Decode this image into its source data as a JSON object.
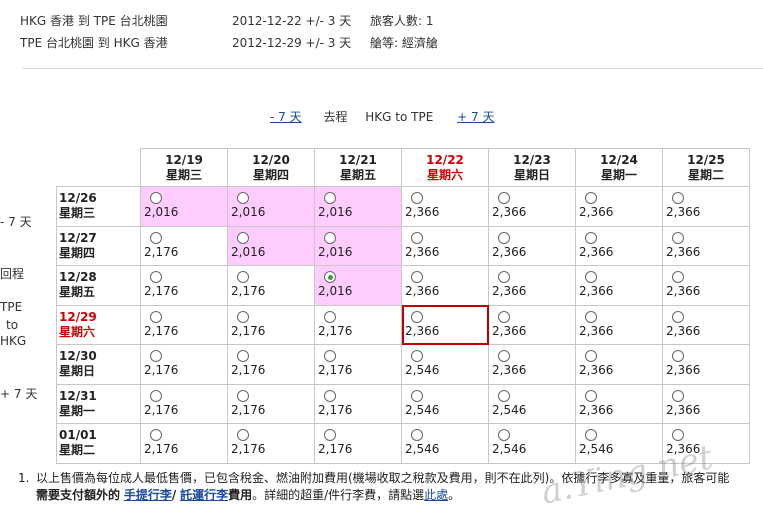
{
  "summary": {
    "outbound": {
      "route": "HKG 香港 到 TPE 台北桃園",
      "date": "2012-12-22  +/- 3 天",
      "info": "旅客人數:  1"
    },
    "inbound": {
      "route": "TPE 台北桃園 到 HKG 香港",
      "date": "2012-12-29  +/- 3 天",
      "info": "艙等:  經濟艙"
    }
  },
  "outbound_nav": {
    "prev": "- 7 天",
    "label": "去程",
    "route": "HKG  to  TPE",
    "next": "+ 7 天"
  },
  "return_nav": {
    "prev": "- 7 天",
    "label": "回程",
    "route_from": "TPE",
    "route_to": "to",
    "route_dest": "HKG",
    "next": "+ 7 天"
  },
  "grid": {
    "columns": [
      {
        "date": "12/19",
        "day": "星期三"
      },
      {
        "date": "12/20",
        "day": "星期四"
      },
      {
        "date": "12/21",
        "day": "星期五"
      },
      {
        "date": "12/22",
        "day": "星期六"
      },
      {
        "date": "12/23",
        "day": "星期日"
      },
      {
        "date": "12/24",
        "day": "星期一"
      },
      {
        "date": "12/25",
        "day": "星期二"
      }
    ],
    "highlight_column": 3,
    "rows": [
      {
        "date": "12/26",
        "day": "星期三",
        "prices": [
          "2,016",
          "2,016",
          "2,016",
          "2,366",
          "2,366",
          "2,366",
          "2,366"
        ]
      },
      {
        "date": "12/27",
        "day": "星期四",
        "prices": [
          "2,176",
          "2,016",
          "2,016",
          "2,366",
          "2,366",
          "2,366",
          "2,366"
        ]
      },
      {
        "date": "12/28",
        "day": "星期五",
        "prices": [
          "2,176",
          "2,176",
          "2,016",
          "2,366",
          "2,366",
          "2,366",
          "2,366"
        ]
      },
      {
        "date": "12/29",
        "day": "星期六",
        "prices": [
          "2,176",
          "2,176",
          "2,176",
          "2,366",
          "2,366",
          "2,366",
          "2,366"
        ]
      },
      {
        "date": "12/30",
        "day": "星期日",
        "prices": [
          "2,176",
          "2,176",
          "2,176",
          "2,546",
          "2,366",
          "2,366",
          "2,366"
        ]
      },
      {
        "date": "12/31",
        "day": "星期一",
        "prices": [
          "2,176",
          "2,176",
          "2,176",
          "2,546",
          "2,546",
          "2,366",
          "2,366"
        ]
      },
      {
        "date": "01/01",
        "day": "星期二",
        "prices": [
          "2,176",
          "2,176",
          "2,176",
          "2,546",
          "2,546",
          "2,546",
          "2,366"
        ]
      }
    ],
    "highlight_row": 3,
    "pink_cells": [
      [
        0,
        0
      ],
      [
        0,
        1
      ],
      [
        0,
        2
      ],
      [
        1,
        1
      ],
      [
        1,
        2
      ],
      [
        2,
        2
      ]
    ],
    "checked_cell": [
      2,
      2
    ],
    "selected_cell": [
      3,
      3
    ],
    "colors": {
      "pink": "#ffccff",
      "highlight": "#cc0000",
      "selected_border": "#c00000",
      "link": "#1a4a9c"
    }
  },
  "note": {
    "number": "1.",
    "line1": "以上售價為每位成人最低售價，已包含稅金、燃油附加費用(機場收取之稅款及費用，則不在此列)。依據行李多寡及重量，旅客可能",
    "line2_prefix": "需要支付額外的",
    "link_carry": "手提行李",
    "sep": "/",
    "link_checked": "託運行李",
    "line2_mid": "費用。詳細的超重/件行李費，請點選",
    "link_here": "此處",
    "line2_end": "。"
  }
}
